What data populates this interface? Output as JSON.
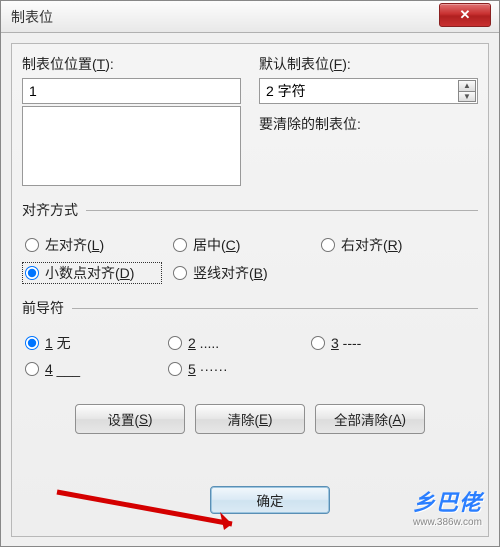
{
  "titlebar": {
    "title": "制表位"
  },
  "tab_position": {
    "label": "制表位位置(T):",
    "value": "1"
  },
  "default_tab": {
    "label": "默认制表位(F):",
    "value": "2 字符"
  },
  "clear_list": {
    "label": "要清除的制表位:"
  },
  "alignment": {
    "legend": "对齐方式",
    "options": [
      {
        "label": "左对齐(L)",
        "checked": false
      },
      {
        "label": "居中(C)",
        "checked": false
      },
      {
        "label": "右对齐(R)",
        "checked": false
      },
      {
        "label": "小数点对齐(D)",
        "checked": true
      },
      {
        "label": "竖线对齐(B)",
        "checked": false
      }
    ]
  },
  "leader": {
    "legend": "前导符",
    "options": [
      {
        "label": "1 无",
        "checked": true
      },
      {
        "label": "2 .....",
        "checked": false
      },
      {
        "label": "3 ----",
        "checked": false
      },
      {
        "label": "4 ___",
        "checked": false
      },
      {
        "label": "5 ······",
        "checked": false
      }
    ]
  },
  "buttons": {
    "set": "设置(S)",
    "clear": "清除(E)",
    "clear_all": "全部清除(A)",
    "ok": "确定"
  },
  "watermark": {
    "main": "乡巴佬",
    "sub": "www.386w.com"
  }
}
